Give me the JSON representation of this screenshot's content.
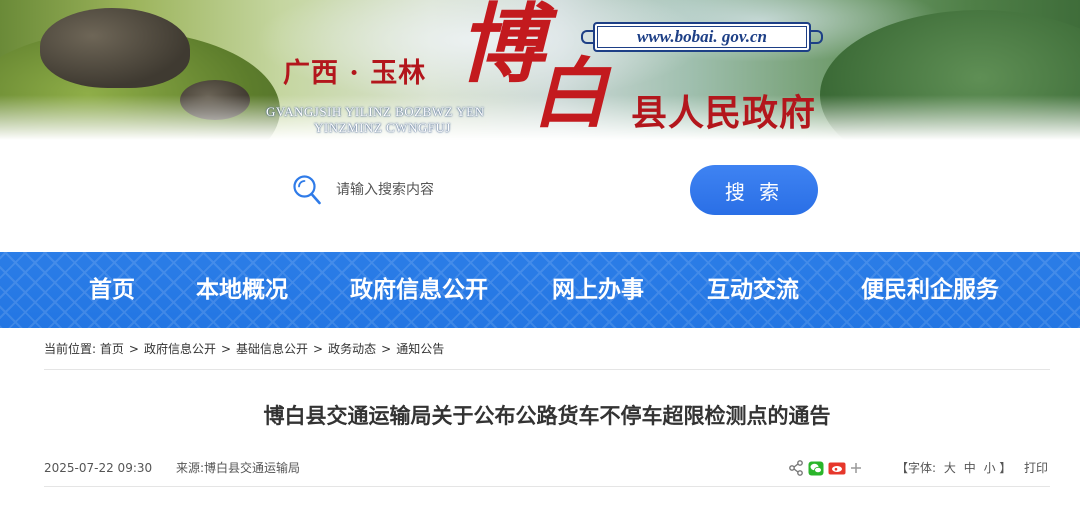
{
  "header": {
    "region": "广西 · 玉林",
    "name_char1": "博",
    "name_char2": "白",
    "gov_suffix": "县人民政府",
    "zhuang_line1": "GVANGJSIH YILINZ BOZBWZ YEN",
    "zhuang_line2": "YINZMINZ CWNGFUJ",
    "url": "www.bobai. gov.cn"
  },
  "search": {
    "placeholder": "请输入搜索内容",
    "value": "",
    "button_label": "搜 索"
  },
  "nav": {
    "items": [
      {
        "label": "首页"
      },
      {
        "label": "本地概况"
      },
      {
        "label": "政府信息公开"
      },
      {
        "label": "网上办事"
      },
      {
        "label": "互动交流"
      },
      {
        "label": "便民利企服务"
      }
    ]
  },
  "breadcrumb": {
    "prefix": "当前位置:",
    "items": [
      "首页",
      "政府信息公开",
      "基础信息公开",
      "政务动态",
      "通知公告"
    ],
    "separator": ">"
  },
  "article": {
    "title": "博白县交通运输局关于公布公路货车不停车超限检测点的通告",
    "date": "2025-07-22 09:30",
    "source_label": "来源:",
    "source": "博白县交通运输局"
  },
  "tools": {
    "icons": [
      "share-icon",
      "wechat-icon",
      "weibo-icon",
      "plus-icon"
    ],
    "font_label": "【字体:",
    "font_large": "大",
    "font_medium": "中",
    "font_small": "小",
    "font_close": "】",
    "print_label": "打印"
  },
  "colors": {
    "nav_bg": "#2376e3",
    "search_button": "#2a6fe6",
    "logo_red": "#c31a1e",
    "url_blue": "#1d3f86"
  }
}
